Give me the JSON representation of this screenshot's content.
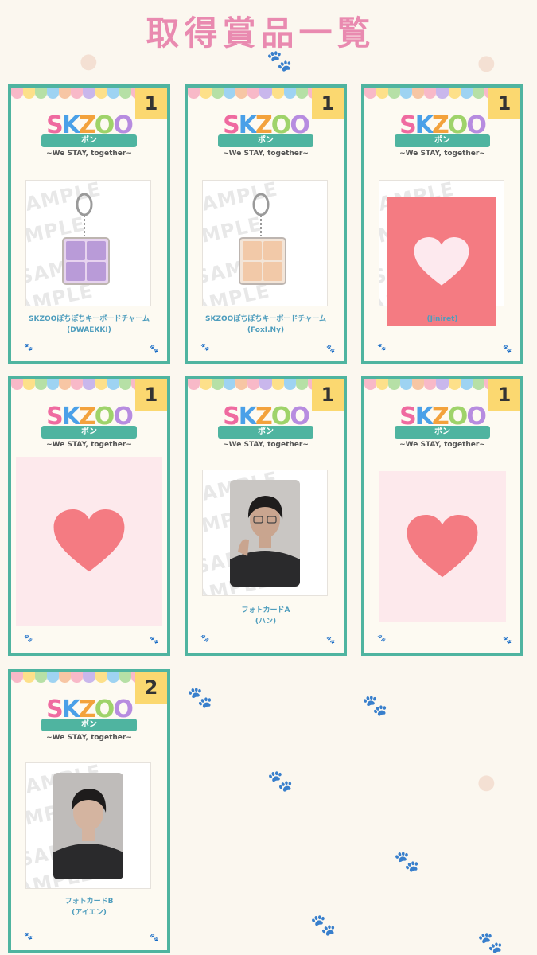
{
  "page": {
    "title": "取得賞品一覧"
  },
  "colors": {
    "frame": "#4fb4a0",
    "badge": "#fbd870",
    "pink": "#e98ab0",
    "heart_pink_bg": "#fde9ec",
    "heart_coral_bg": "#f47b82"
  },
  "logo": {
    "brand": "SKZOO",
    "sub": "ポン",
    "tagline": "~We STAY, together~"
  },
  "watermark": "SAMPLE",
  "cards": [
    {
      "count": "1",
      "name_line1": "SKZOOぽちぽちキーボードチャーム",
      "name_line2": "(DWAEKKI)",
      "image": "keyboard-charm-pink"
    },
    {
      "count": "1",
      "name_line1": "SKZOOぽちぽちキーボードチャーム",
      "name_line2": "(FoxI.Ny)",
      "image": "keyboard-charm-beige"
    },
    {
      "count": "1",
      "name_line1": "",
      "name_line2": "(Jiniret)",
      "image": "heart-cover-coral"
    },
    {
      "count": "1",
      "name_line1": "",
      "name_line2": "",
      "image": "heart-cover-pink"
    },
    {
      "count": "1",
      "name_line1": "フォトカードA",
      "name_line2": "(ハン)",
      "image": "photocard-person-a"
    },
    {
      "count": "1",
      "name_line1": "",
      "name_line2": "",
      "image": "heart-cover-pink"
    },
    {
      "count": "2",
      "name_line1": "フォトカードB",
      "name_line2": "(アイエン)",
      "image": "photocard-person-b"
    }
  ]
}
